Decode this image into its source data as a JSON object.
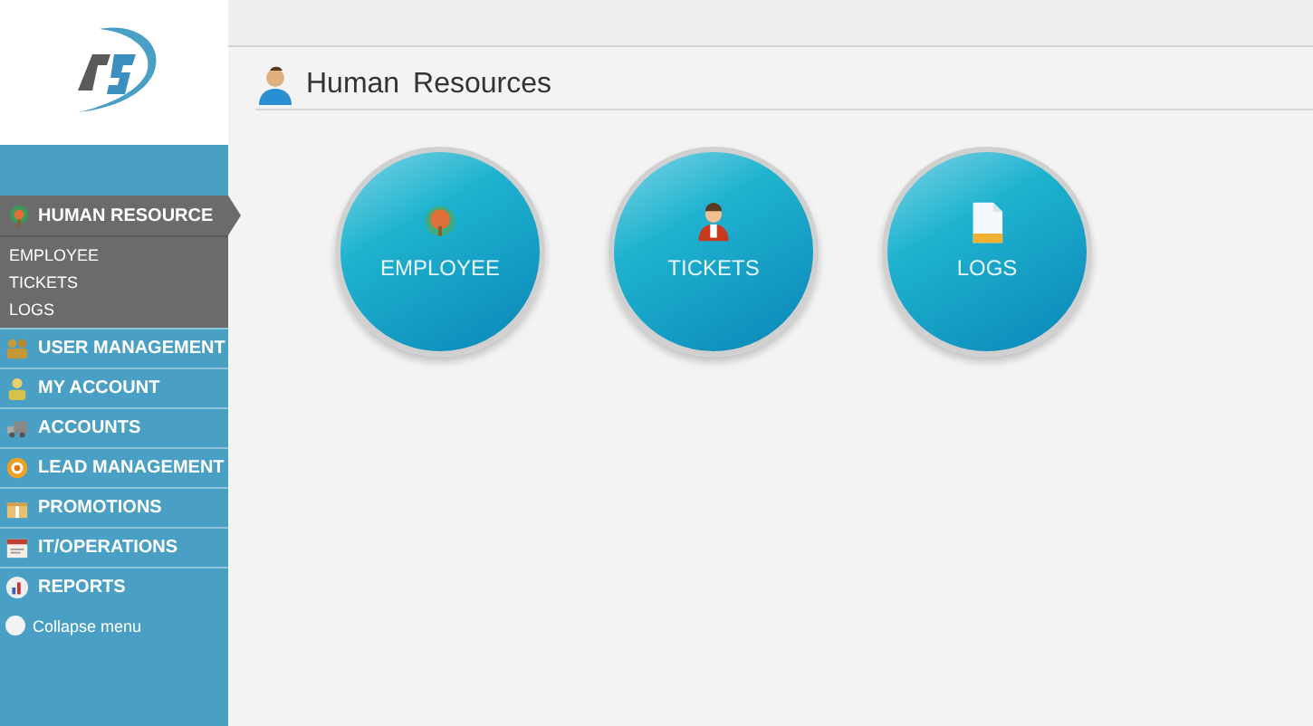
{
  "sidebar": {
    "active_section": {
      "label": "HUMAN RESOURCE",
      "expanded": true,
      "children": [
        {
          "label": "EMPLOYEE"
        },
        {
          "label": "TICKETS"
        },
        {
          "label": "LOGS"
        }
      ]
    },
    "items": [
      {
        "label": "USER MANAGEMENT",
        "kind": "users"
      },
      {
        "label": "MY ACCOUNT",
        "kind": "person"
      },
      {
        "label": "ACCOUNTS",
        "kind": "truck"
      },
      {
        "label": "LEAD MANAGEMENT",
        "kind": "target"
      },
      {
        "label": "PROMOTIONS",
        "kind": "gift"
      },
      {
        "label": "IT/OPERATIONS",
        "kind": "calendar"
      },
      {
        "label": "REPORTS",
        "kind": "chart"
      }
    ],
    "collapse": {
      "label": "Collapse menu"
    }
  },
  "page": {
    "title": "Human Resources",
    "tiles": [
      {
        "label": "EMPLOYEE",
        "kind": "tree"
      },
      {
        "label": "TICKETS",
        "kind": "agent"
      },
      {
        "label": "LOGS",
        "kind": "file"
      }
    ]
  }
}
